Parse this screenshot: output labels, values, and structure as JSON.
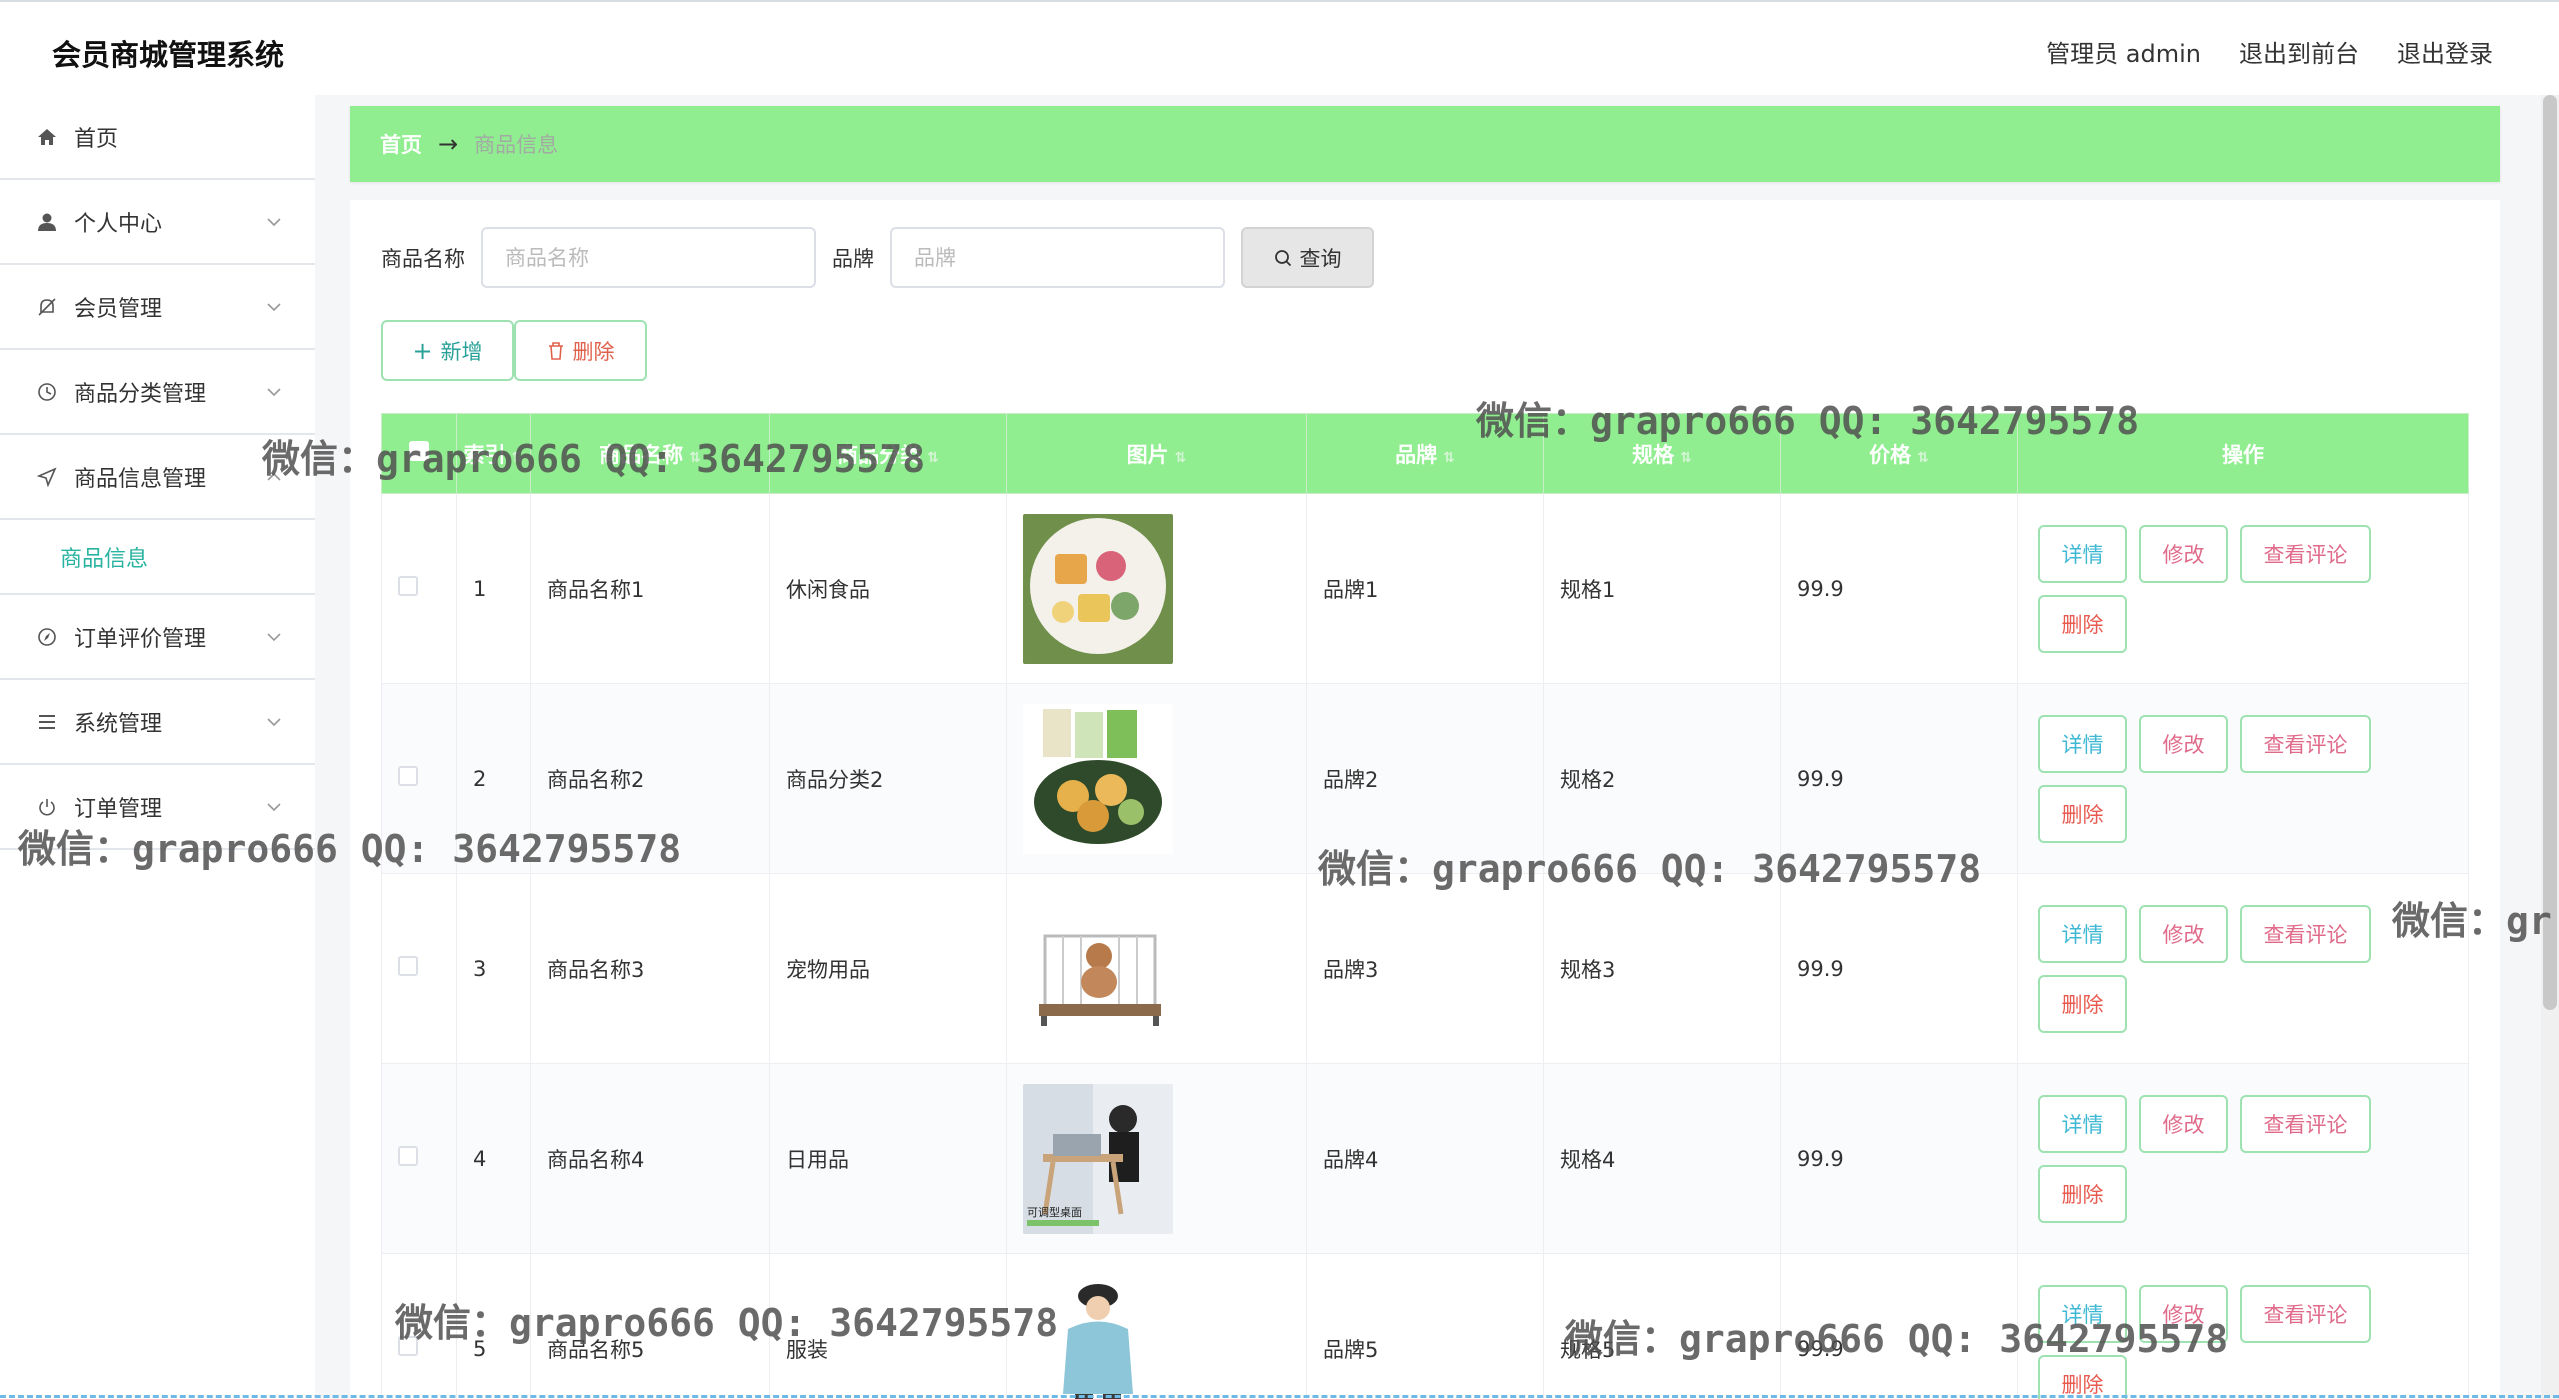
{
  "app": {
    "title": "会员商城管理系统"
  },
  "header": {
    "admin": "管理员 admin",
    "front": "退出到前台",
    "logout": "退出登录"
  },
  "sidebar": {
    "items": [
      {
        "label": "首页",
        "icon": "home-icon"
      },
      {
        "label": "个人中心",
        "icon": "user-icon"
      },
      {
        "label": "会员管理",
        "icon": "bell-off-icon"
      },
      {
        "label": "商品分类管理",
        "icon": "clock-icon"
      },
      {
        "label": "商品信息管理",
        "icon": "send-icon"
      },
      {
        "label": "订单评价管理",
        "icon": "compass-icon"
      },
      {
        "label": "系统管理",
        "icon": "list-icon"
      },
      {
        "label": "订单管理",
        "icon": "power-icon"
      }
    ],
    "sub": "商品信息"
  },
  "breadcrumb": {
    "home": "首页",
    "separator": "→",
    "current": "商品信息"
  },
  "search": {
    "name_label": "商品名称",
    "name_placeholder": "商品名称",
    "brand_label": "品牌",
    "brand_placeholder": "品牌",
    "query": "查询"
  },
  "actions": {
    "add": "新增",
    "delete": "删除"
  },
  "table": {
    "headers": [
      "索引",
      "商品名称",
      "商品分类",
      "图片",
      "品牌",
      "规格",
      "价格",
      "操作"
    ],
    "ops": {
      "detail": "详情",
      "edit": "修改",
      "review": "查看评论",
      "delete": "删除"
    },
    "rows": [
      {
        "index": "1",
        "name": "商品名称1",
        "category": "休闲食品",
        "brand": "品牌1",
        "spec": "规格1",
        "price": "99.9",
        "thumb": "mooncake-plate"
      },
      {
        "index": "2",
        "name": "商品名称2",
        "category": "商品分类2",
        "brand": "品牌2",
        "spec": "规格2",
        "price": "99.9",
        "thumb": "snack-bowl"
      },
      {
        "index": "3",
        "name": "商品名称3",
        "category": "宠物用品",
        "brand": "品牌3",
        "spec": "规格3",
        "price": "99.9",
        "thumb": "dog-cage"
      },
      {
        "index": "4",
        "name": "商品名称4",
        "category": "日用品",
        "brand": "品牌4",
        "spec": "规格4",
        "price": "99.9",
        "thumb": "laptop-desk"
      },
      {
        "index": "5",
        "name": "商品名称5",
        "category": "服装",
        "brand": "品牌5",
        "spec": "规格5",
        "price": "99.9",
        "thumb": "hoodie-model"
      }
    ],
    "thumb_caption_4": "可调型桌面"
  },
  "watermark": "微信：grapro666 QQ: 3642795578",
  "watermark_partial": "微信：gr",
  "colors": {
    "accent": "#90ee90",
    "teal": "#29b3a0"
  }
}
